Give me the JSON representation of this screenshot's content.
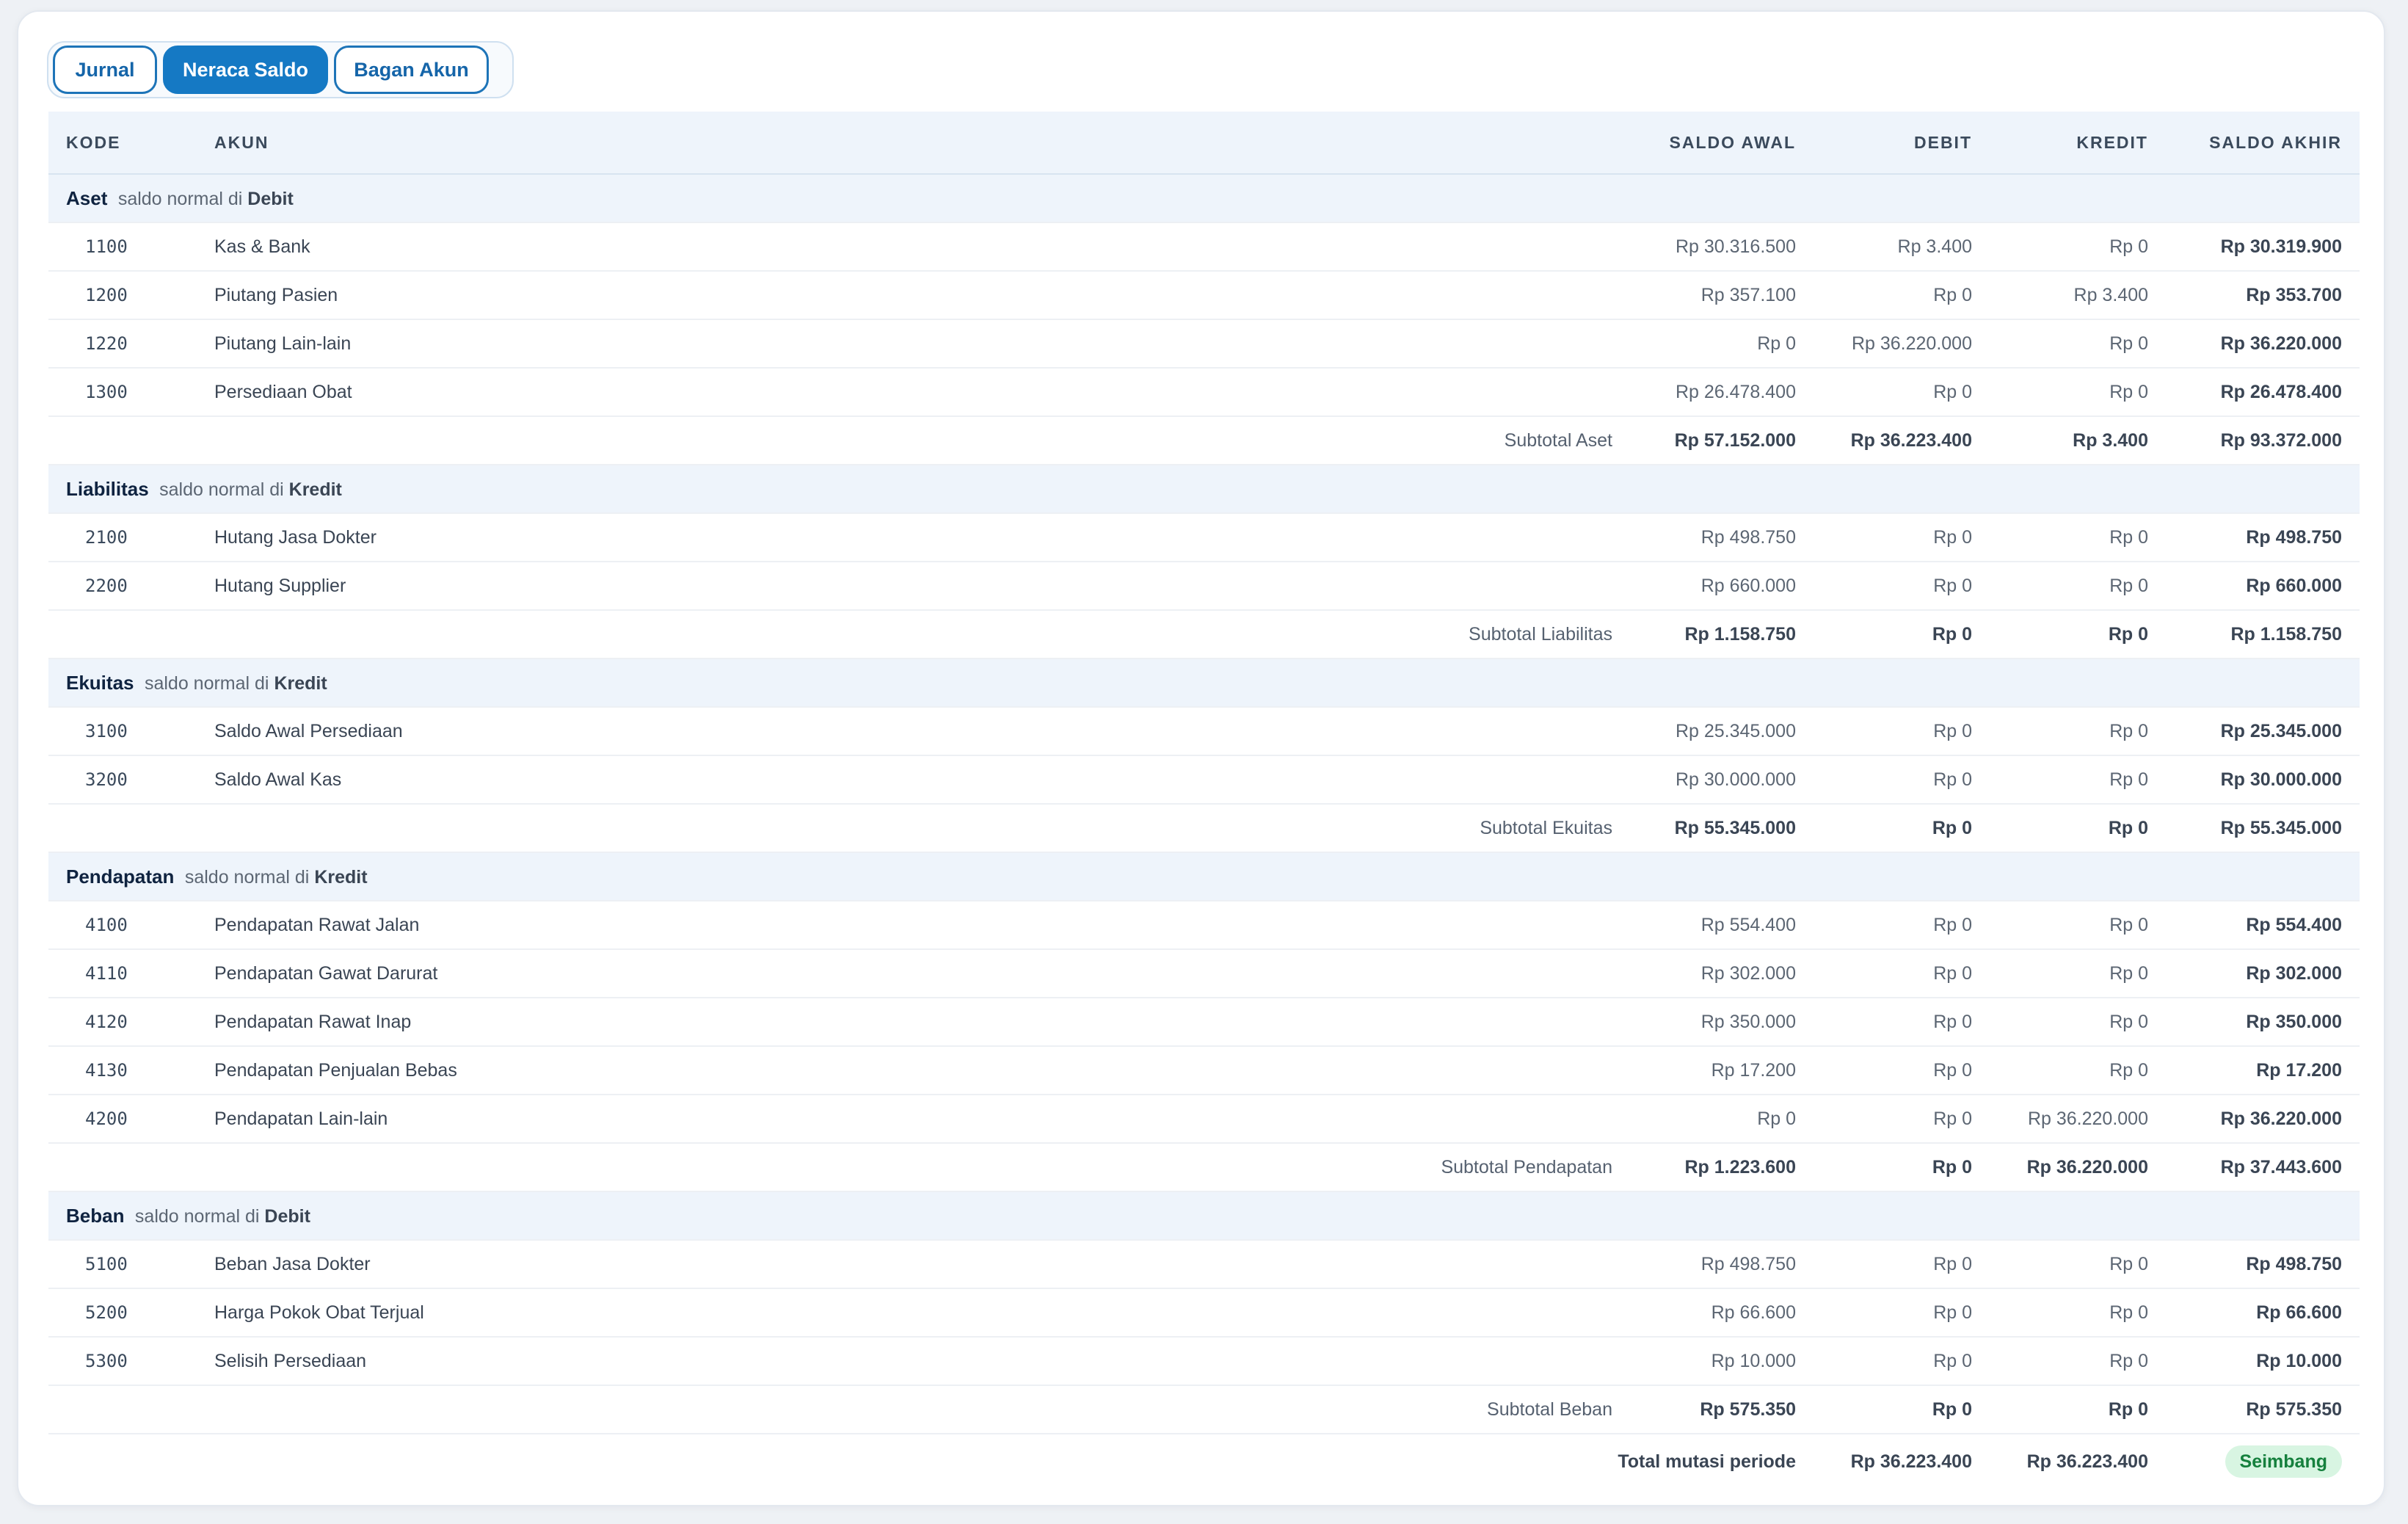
{
  "tabs": [
    {
      "label": "Jurnal",
      "active": false
    },
    {
      "label": "Neraca Saldo",
      "active": true
    },
    {
      "label": "Bagan Akun",
      "active": false
    }
  ],
  "columns": {
    "kode": "KODE",
    "akun": "AKUN",
    "saldo_awal": "SALDO AWAL",
    "debit": "DEBIT",
    "kredit": "KREDIT",
    "saldo_akhir": "SALDO AKHIR"
  },
  "normal_prefix": "saldo normal di",
  "groups": [
    {
      "name": "Aset",
      "normal": "Debit",
      "rows": [
        {
          "kode": "1100",
          "akun": "Kas & Bank",
          "saldo_awal": "Rp 30.316.500",
          "debit": "Rp 3.400",
          "kredit": "Rp 0",
          "saldo_akhir": "Rp 30.319.900"
        },
        {
          "kode": "1200",
          "akun": "Piutang Pasien",
          "saldo_awal": "Rp 357.100",
          "debit": "Rp 0",
          "kredit": "Rp 3.400",
          "saldo_akhir": "Rp 353.700"
        },
        {
          "kode": "1220",
          "akun": "Piutang Lain-lain",
          "saldo_awal": "Rp 0",
          "debit": "Rp 36.220.000",
          "kredit": "Rp 0",
          "saldo_akhir": "Rp 36.220.000"
        },
        {
          "kode": "1300",
          "akun": "Persediaan Obat",
          "saldo_awal": "Rp 26.478.400",
          "debit": "Rp 0",
          "kredit": "Rp 0",
          "saldo_akhir": "Rp 26.478.400"
        }
      ],
      "subtotal": {
        "label": "Subtotal Aset",
        "saldo_awal": "Rp 57.152.000",
        "debit": "Rp 36.223.400",
        "kredit": "Rp 3.400",
        "saldo_akhir": "Rp 93.372.000"
      }
    },
    {
      "name": "Liabilitas",
      "normal": "Kredit",
      "rows": [
        {
          "kode": "2100",
          "akun": "Hutang Jasa Dokter",
          "saldo_awal": "Rp 498.750",
          "debit": "Rp 0",
          "kredit": "Rp 0",
          "saldo_akhir": "Rp 498.750"
        },
        {
          "kode": "2200",
          "akun": "Hutang Supplier",
          "saldo_awal": "Rp 660.000",
          "debit": "Rp 0",
          "kredit": "Rp 0",
          "saldo_akhir": "Rp 660.000"
        }
      ],
      "subtotal": {
        "label": "Subtotal Liabilitas",
        "saldo_awal": "Rp 1.158.750",
        "debit": "Rp 0",
        "kredit": "Rp 0",
        "saldo_akhir": "Rp 1.158.750"
      }
    },
    {
      "name": "Ekuitas",
      "normal": "Kredit",
      "rows": [
        {
          "kode": "3100",
          "akun": "Saldo Awal Persediaan",
          "saldo_awal": "Rp 25.345.000",
          "debit": "Rp 0",
          "kredit": "Rp 0",
          "saldo_akhir": "Rp 25.345.000"
        },
        {
          "kode": "3200",
          "akun": "Saldo Awal Kas",
          "saldo_awal": "Rp 30.000.000",
          "debit": "Rp 0",
          "kredit": "Rp 0",
          "saldo_akhir": "Rp 30.000.000"
        }
      ],
      "subtotal": {
        "label": "Subtotal Ekuitas",
        "saldo_awal": "Rp 55.345.000",
        "debit": "Rp 0",
        "kredit": "Rp 0",
        "saldo_akhir": "Rp 55.345.000"
      }
    },
    {
      "name": "Pendapatan",
      "normal": "Kredit",
      "rows": [
        {
          "kode": "4100",
          "akun": "Pendapatan Rawat Jalan",
          "saldo_awal": "Rp 554.400",
          "debit": "Rp 0",
          "kredit": "Rp 0",
          "saldo_akhir": "Rp 554.400"
        },
        {
          "kode": "4110",
          "akun": "Pendapatan Gawat Darurat",
          "saldo_awal": "Rp 302.000",
          "debit": "Rp 0",
          "kredit": "Rp 0",
          "saldo_akhir": "Rp 302.000"
        },
        {
          "kode": "4120",
          "akun": "Pendapatan Rawat Inap",
          "saldo_awal": "Rp 350.000",
          "debit": "Rp 0",
          "kredit": "Rp 0",
          "saldo_akhir": "Rp 350.000"
        },
        {
          "kode": "4130",
          "akun": "Pendapatan Penjualan Bebas",
          "saldo_awal": "Rp 17.200",
          "debit": "Rp 0",
          "kredit": "Rp 0",
          "saldo_akhir": "Rp 17.200"
        },
        {
          "kode": "4200",
          "akun": "Pendapatan Lain-lain",
          "saldo_awal": "Rp 0",
          "debit": "Rp 0",
          "kredit": "Rp 36.220.000",
          "saldo_akhir": "Rp 36.220.000"
        }
      ],
      "subtotal": {
        "label": "Subtotal Pendapatan",
        "saldo_awal": "Rp 1.223.600",
        "debit": "Rp 0",
        "kredit": "Rp 36.220.000",
        "saldo_akhir": "Rp 37.443.600"
      }
    },
    {
      "name": "Beban",
      "normal": "Debit",
      "rows": [
        {
          "kode": "5100",
          "akun": "Beban Jasa Dokter",
          "saldo_awal": "Rp 498.750",
          "debit": "Rp 0",
          "kredit": "Rp 0",
          "saldo_akhir": "Rp 498.750"
        },
        {
          "kode": "5200",
          "akun": "Harga Pokok Obat Terjual",
          "saldo_awal": "Rp 66.600",
          "debit": "Rp 0",
          "kredit": "Rp 0",
          "saldo_akhir": "Rp 66.600"
        },
        {
          "kode": "5300",
          "akun": "Selisih Persediaan",
          "saldo_awal": "Rp 10.000",
          "debit": "Rp 0",
          "kredit": "Rp 0",
          "saldo_akhir": "Rp 10.000"
        }
      ],
      "subtotal": {
        "label": "Subtotal Beban",
        "saldo_awal": "Rp 575.350",
        "debit": "Rp 0",
        "kredit": "Rp 0",
        "saldo_akhir": "Rp 575.350"
      }
    }
  ],
  "total": {
    "label": "Total mutasi periode",
    "debit": "Rp 36.223.400",
    "kredit": "Rp 36.223.400",
    "status": "Seimbang"
  },
  "colors": {
    "accent": "#1579c4",
    "header_bg": "#eef4fb",
    "balanced_bg": "#d8f5e2",
    "balanced_text": "#15803d"
  }
}
